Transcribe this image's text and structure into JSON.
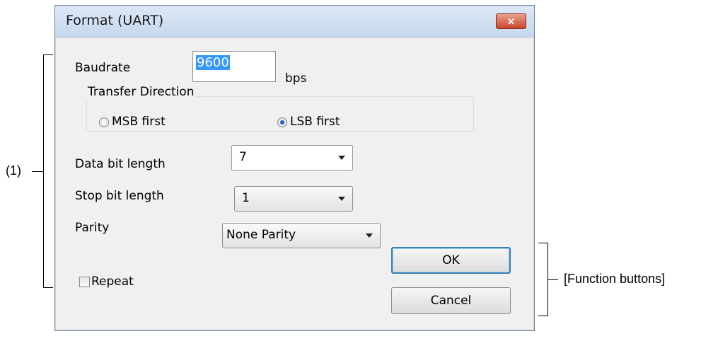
{
  "dialog": {
    "title": "Format (UART)",
    "close_glyph": "×",
    "baudrate_label": "Baudrate",
    "baudrate_value": "9600",
    "baudrate_unit": "bps",
    "transfer_direction_title": "Transfer Direction",
    "radio_msb_label": "MSB first",
    "radio_lsb_label": "LSB first",
    "selected_direction": "LSB first",
    "data_bit_label": "Data bit length",
    "data_bit_value": "7",
    "stop_bit_label": "Stop bit length",
    "stop_bit_value": "1",
    "parity_label": "Parity",
    "parity_value": "None Parity",
    "repeat_label": "Repeat",
    "repeat_checked": false,
    "ok_label": "OK",
    "cancel_label": "Cancel"
  },
  "annotations": {
    "area_label": "(1)",
    "buttons_label": "[Function buttons]"
  },
  "icons": {
    "close": "close-icon",
    "dropdown": "chevron-down-icon"
  },
  "colors": {
    "close_button": "#c9462e",
    "selection_highlight": "#3399ff",
    "default_button_border": "#3c7fb1"
  }
}
